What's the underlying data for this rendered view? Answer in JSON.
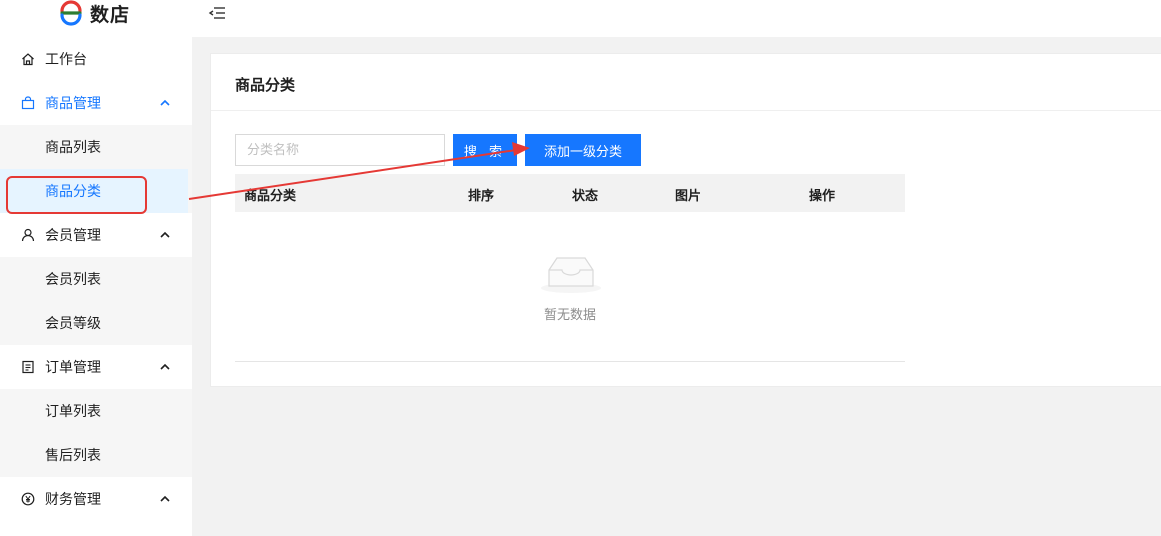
{
  "app": {
    "name": "数店"
  },
  "sidebar": {
    "items": [
      {
        "label": "工作台",
        "icon": "home-icon"
      },
      {
        "label": "商品管理",
        "icon": "bag-icon",
        "children": [
          "商品列表",
          "商品分类"
        ]
      },
      {
        "label": "会员管理",
        "icon": "user-icon",
        "children": [
          "会员列表",
          "会员等级"
        ]
      },
      {
        "label": "订单管理",
        "icon": "document-icon",
        "children": [
          "订单列表",
          "售后列表"
        ]
      },
      {
        "label": "财务管理",
        "icon": "yen-icon"
      }
    ]
  },
  "page": {
    "title": "商品分类",
    "search": {
      "placeholder": "分类名称",
      "value": ""
    },
    "buttons": {
      "search": "搜 索",
      "add": "添加一级分类"
    },
    "table": {
      "columns": [
        "商品分类",
        "排序",
        "状态",
        "图片",
        "操作"
      ],
      "empty_text": "暂无数据"
    }
  },
  "colors": {
    "primary": "#1677ff",
    "annotation": "#e53935"
  }
}
